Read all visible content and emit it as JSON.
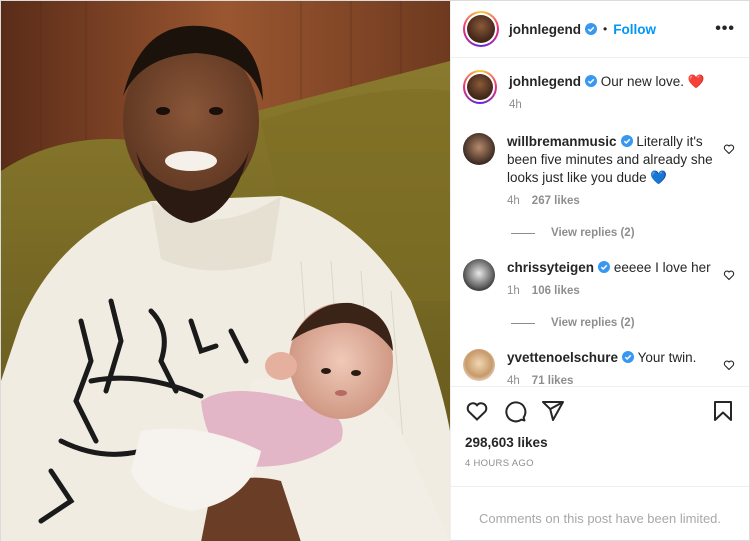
{
  "post": {
    "username": "johnlegend",
    "follow_label": "Follow",
    "separator": "•",
    "more_label": "•••"
  },
  "caption": {
    "username": "johnlegend",
    "text": "Our new love. ❤️",
    "time": "4h"
  },
  "comments": [
    {
      "username": "willbremanmusic",
      "text": "Literally it's been five minutes and already she looks just like you dude 💙",
      "time": "4h",
      "likes": "267 likes",
      "replies": "View replies (2)"
    },
    {
      "username": "chrissyteigen",
      "text": "eeeee I love her",
      "time": "1h",
      "likes": "106 likes",
      "replies": "View replies (2)"
    },
    {
      "username": "yvettenoelschure",
      "text": "Your twin.",
      "time": "4h",
      "likes": "71 likes"
    }
  ],
  "stats": {
    "likes": "298,603 likes",
    "time_ago": "4 HOURS AGO"
  },
  "footer": {
    "limited_text": "Comments on this post have been limited."
  },
  "icons": {
    "like": "heart-icon",
    "comment": "comment-icon",
    "share": "share-icon",
    "save": "bookmark-icon",
    "verified": "verified-badge-icon"
  },
  "colors": {
    "accent": "#0095f6",
    "verified": "#3897f0",
    "muted": "#8e8e8e",
    "text": "#262626"
  }
}
